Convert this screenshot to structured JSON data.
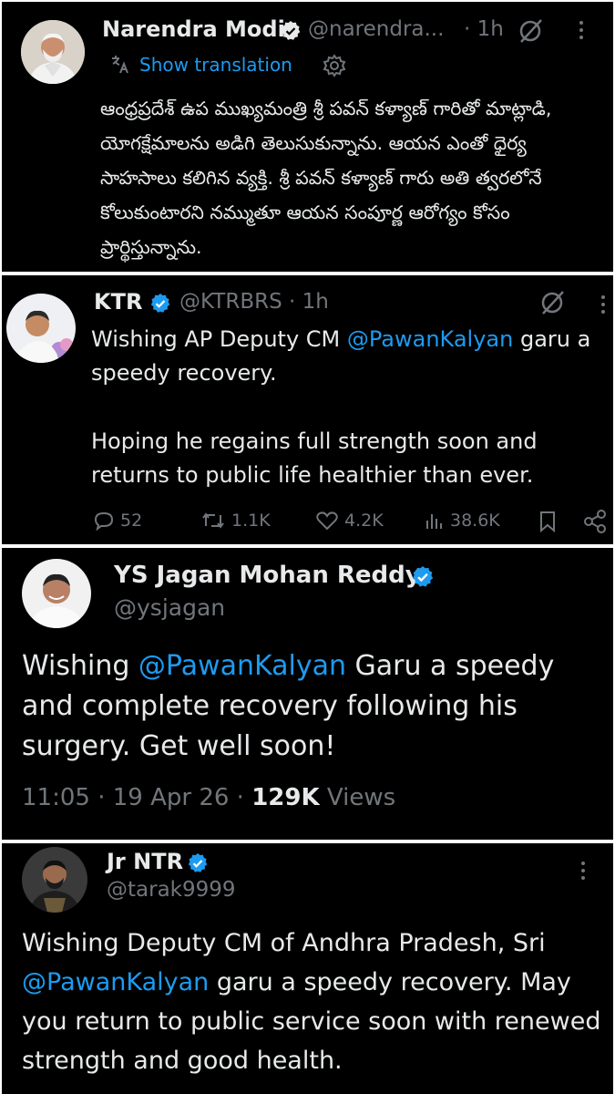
{
  "tweets": [
    {
      "name": "Narendra Modi",
      "handle": "@narendra...",
      "time": "· 1h",
      "translate_label": "Show translation",
      "text": "ఆంధ్రప్రదేశ్ ఉప ముఖ్యమంత్రి శ్రీ పవన్ కళ్యాణ్ గారితో మాట్లాడి, యోగక్షేమాలను అడిగి తెలుసుకున్నాను. ఆయన ఎంతో ధైర్య సాహసాలు కలిగిన వ్యక్తి. శ్రీ పవన్ కళ్యాణ్ గారు అతి త్వరలోనే కోలుకుంటారని నమ్ముతూ ఆయన సంపూర్ణ ఆరోగ్యం కోసం ప్రార్థిస్తున్నాను."
    },
    {
      "name": "KTR",
      "handle": "@KTRBRS · 1h",
      "text_parts": [
        "Wishing AP Deputy CM ",
        "@PawanKalyan",
        " garu a speedy recovery."
      ],
      "text2": "Hoping he regains full strength soon and returns to public life healthier than ever.",
      "stats": {
        "replies": "52",
        "reposts": "1.1K",
        "likes": "4.2K",
        "views": "38.6K"
      }
    },
    {
      "name": "YS Jagan Mohan Reddy",
      "handle": "@ysjagan",
      "text_parts": [
        "Wishing ",
        "@PawanKalyan",
        " Garu a speedy and complete recovery following his surgery. Get well soon!"
      ],
      "time": "11:05 · 19 Apr 26 · ",
      "views_count": "129K",
      "views_label": " Views"
    },
    {
      "name": "Jr NTR",
      "handle": "@tarak9999",
      "text_parts": [
        "Wishing Deputy CM of Andhra Pradesh, Sri ",
        "@PawanKalyan",
        " garu a speedy recovery. May you return to public service soon with renewed strength and good health."
      ]
    }
  ],
  "colors": {
    "accent": "#1d9bf0",
    "muted": "#71767b",
    "text": "#e7e9ea",
    "background": "#000000"
  },
  "icons": [
    "verified-badge-icon",
    "grok-icon",
    "more-icon",
    "translate-icon",
    "settings-gear-icon",
    "reply-icon",
    "repost-icon",
    "like-icon",
    "views-icon",
    "bookmark-icon",
    "share-icon"
  ]
}
